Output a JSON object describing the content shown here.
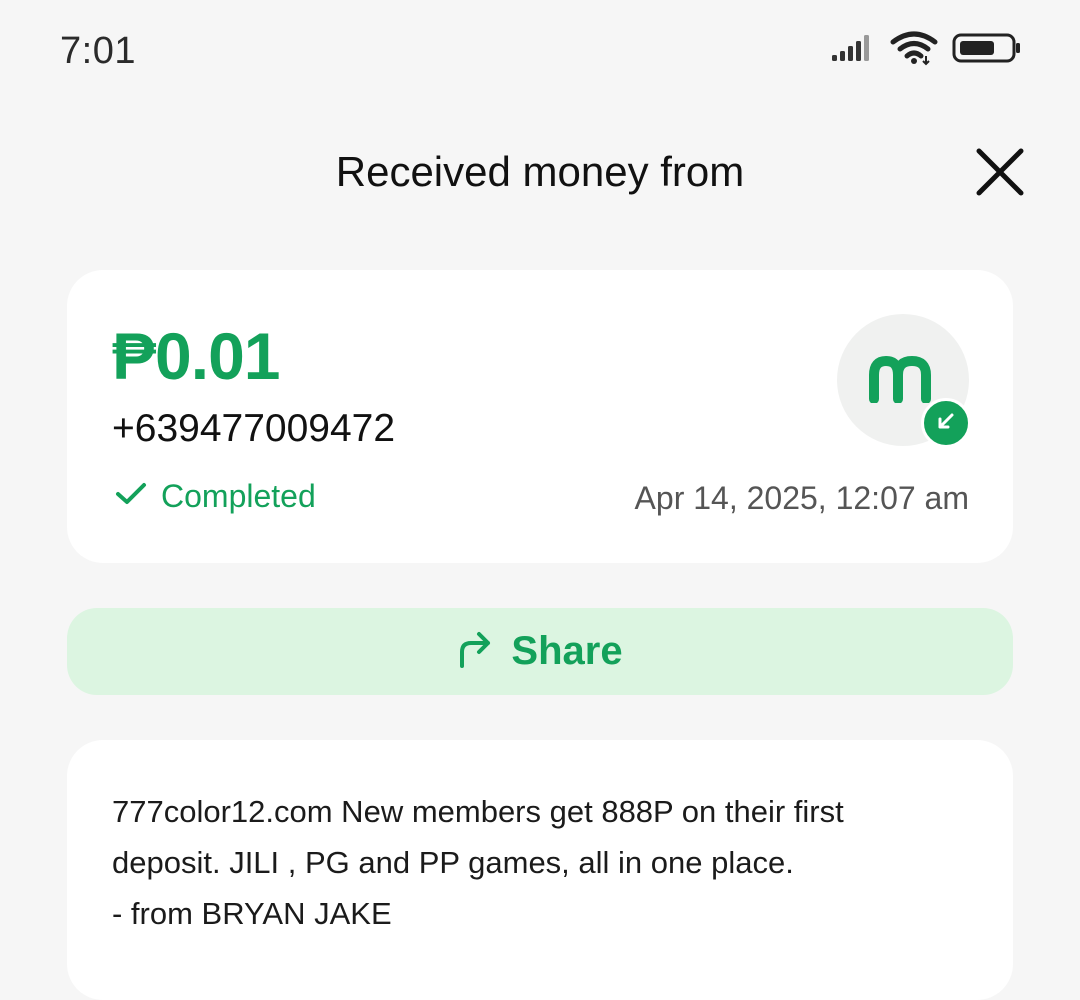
{
  "status_bar": {
    "time": "7:01",
    "icons": [
      "signal-icon",
      "wifi-icon",
      "battery-icon"
    ]
  },
  "header": {
    "title": "Received money from",
    "close_icon": "close-icon"
  },
  "transaction": {
    "amount": "₱0.01",
    "phone": "+639477009472",
    "status": "Completed",
    "datetime": "Apr 14, 2025, 12:07 am",
    "avatar_icon": "maya-logo-icon",
    "badge_icon": "arrow-down-left-icon"
  },
  "share": {
    "label": "Share",
    "icon": "share-arrow-icon"
  },
  "message": {
    "text": "777color12.com New members get 888P on their first\ndeposit. JILI , PG and PP games, all in one place.\n- from BRYAN JAKE"
  },
  "colors": {
    "accent": "#13a15a",
    "share_bg": "#dcf5e1",
    "page_bg": "#f6f6f6",
    "card_bg": "#ffffff"
  }
}
